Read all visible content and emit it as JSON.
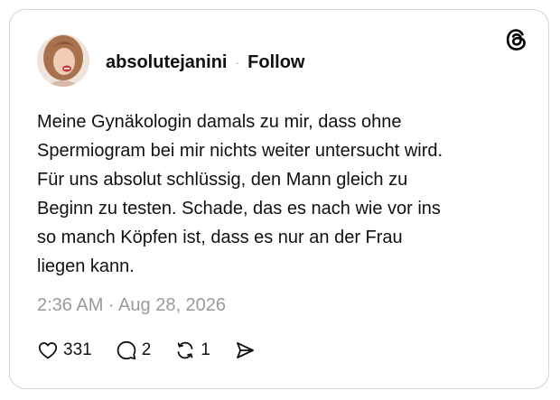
{
  "post": {
    "username": "absolutejanini",
    "separator": "·",
    "follow_label": "Follow",
    "text": "Meine Gynäkologin damals zu mir, dass ohne\nSpermiogram bei mir nichts weiter untersucht wird.\nFür uns absolut schlüssig, den Mann gleich zu\nBeginn zu testen. Schade, das es nach wie vor ins\nso manch Köpfen ist, dass es nur an der Frau\nliegen kann.",
    "timestamp": "2:36 AM · Aug 28, 2026"
  },
  "actions": {
    "likes": "331",
    "replies": "2",
    "reposts": "1"
  },
  "icons": {
    "brand": "threads-logo-icon",
    "like": "heart-icon",
    "reply": "speech-bubble-icon",
    "repost": "repost-icon",
    "share": "send-icon"
  },
  "colors": {
    "text": "#111111",
    "muted": "#9a9a9a",
    "border": "#d4d4d4"
  }
}
